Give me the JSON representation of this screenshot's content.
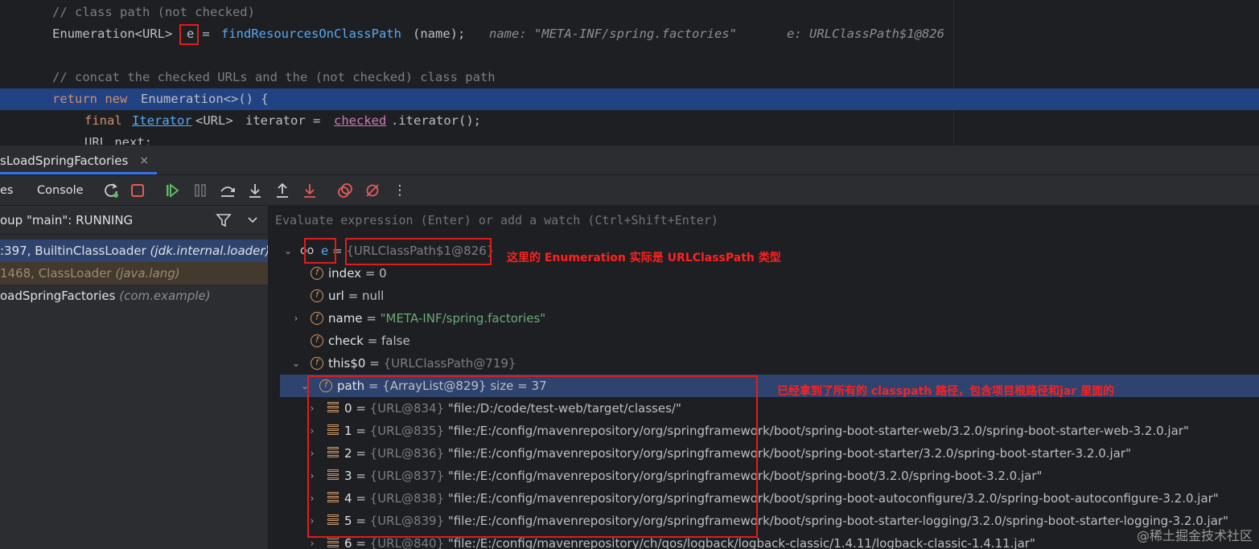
{
  "editor": {
    "lines": [
      {
        "id": "l1",
        "parts": [
          {
            "cls": "c-comment",
            "text": "// class path (not checked)"
          }
        ]
      },
      {
        "id": "l2",
        "parts": [
          {
            "cls": "c-type",
            "text": "Enumeration<URL> "
          },
          {
            "cls": "c-type",
            "text": "e"
          },
          {
            "cls": "c-type",
            "text": " = "
          },
          {
            "cls": "c-fn",
            "text": "findResourcesOnClassPath"
          },
          {
            "cls": "c-type",
            "text": "(name);"
          }
        ]
      },
      {
        "id": "l3",
        "parts": [
          {
            "cls": "c-comment",
            "text": "// concat the checked URLs and the (not checked) class path"
          }
        ]
      },
      {
        "id": "l4",
        "parts": [
          {
            "cls": "c-kw",
            "text": "return new "
          },
          {
            "cls": "c-type",
            "text": "Enumeration<>() {"
          }
        ]
      },
      {
        "id": "l5",
        "parts": [
          {
            "cls": "c-kw",
            "text": "final "
          },
          {
            "cls": "c-link",
            "text": "Iterator"
          },
          {
            "cls": "c-type",
            "text": "<URL> "
          },
          {
            "cls": "c-type",
            "text": "iterator = "
          },
          {
            "cls": "c-under",
            "text": "checked"
          },
          {
            "cls": "c-type",
            "text": ".iterator();"
          }
        ]
      },
      {
        "id": "l6",
        "parts": [
          {
            "cls": "c-type",
            "text": "URL next;"
          }
        ]
      }
    ],
    "hint_name": "name: \"META-INF/spring.factories\"",
    "hint_e": "e: URLClassPath$1@826"
  },
  "debug_tab": {
    "label": "sLoadSpringFactories",
    "close": "×"
  },
  "toolbar": {
    "frames_label": "es",
    "console_label": "Console",
    "more_icon": "⋮"
  },
  "frames": {
    "thread": "oup \"main\": RUNNING",
    "items": [
      {
        "method": ":397, BuiltinClassLoader",
        "pkg": "(jdk.internal.loader)",
        "selected": true
      },
      {
        "method": "1468, ClassLoader",
        "pkg": "(java.lang)",
        "selected": false
      },
      {
        "method": "oadSpringFactories",
        "pkg": "(com.example)",
        "selected": false
      }
    ]
  },
  "variables": {
    "eval_placeholder": "Evaluate expression (Enter) or add a watch (Ctrl+Shift+Enter)",
    "root": {
      "name": "e",
      "eq": " = ",
      "ref": "{URLClassPath$1@826}"
    },
    "fields": [
      {
        "name": "index",
        "eq": " = ",
        "val": "0"
      },
      {
        "name": "url",
        "eq": " = ",
        "val": "null"
      },
      {
        "name": "name",
        "eq": " = ",
        "str": "\"META-INF/spring.factories\""
      },
      {
        "name": "check",
        "eq": " = ",
        "val": "false"
      },
      {
        "name": "this$0",
        "eq": " = ",
        "ref": "{URLClassPath@719}"
      }
    ],
    "path": {
      "name": "path",
      "eq": " = ",
      "val": "{ArrayList@829}",
      "size": "  size = 37"
    },
    "items": [
      {
        "idx": "0",
        "ref": "{URL@834}",
        "str": "\"file:/D:/code/test-web/target/classes/\""
      },
      {
        "idx": "1",
        "ref": "{URL@835}",
        "str": "\"file:/E:/config/mavenrepository/org/springframework/boot/spring-boot-starter-web/3.2.0/spring-boot-starter-web-3.2.0.jar\""
      },
      {
        "idx": "2",
        "ref": "{URL@836}",
        "str": "\"file:/E:/config/mavenrepository/org/springframework/boot/spring-boot-starter/3.2.0/spring-boot-starter-3.2.0.jar\""
      },
      {
        "idx": "3",
        "ref": "{URL@837}",
        "str": "\"file:/E:/config/mavenrepository/org/springframework/boot/spring-boot/3.2.0/spring-boot-3.2.0.jar\""
      },
      {
        "idx": "4",
        "ref": "{URL@838}",
        "str": "\"file:/E:/config/mavenrepository/org/springframework/boot/spring-boot-autoconfigure/3.2.0/spring-boot-autoconfigure-3.2.0.jar\""
      },
      {
        "idx": "5",
        "ref": "{URL@839}",
        "str": "\"file:/E:/config/mavenrepository/org/springframework/boot/spring-boot-starter-logging/3.2.0/spring-boot-starter-logging-3.2.0.jar\""
      },
      {
        "idx": "6",
        "ref": "{URL@840}",
        "str": "\"file:/E:/config/mavenrepository/ch/qos/logback/logback-classic/1.4.11/logback-classic-1.4.11.jar\""
      }
    ]
  },
  "annotations": {
    "note1": "这里的 Enumeration 实际是 URLClassPath 类型",
    "note2": "已经拿到了所有的 classpath 路径，包含项目根路径和jar 里面的"
  },
  "watermark": "@稀土掘金技术社区",
  "colors": {
    "selection": "#214283",
    "accent": "#3574f0",
    "annotation": "#e01d1d"
  }
}
